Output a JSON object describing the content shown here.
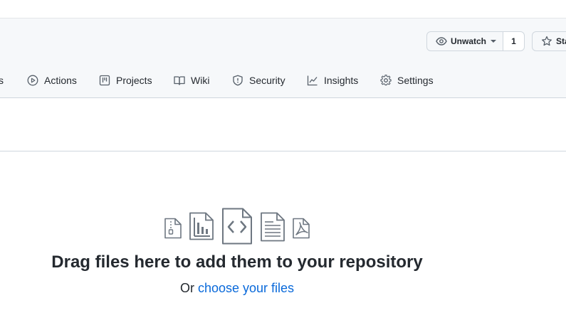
{
  "header": {
    "watch": {
      "label": "Unwatch",
      "count": "1"
    },
    "star": {
      "label": "Star"
    }
  },
  "tabs": [
    {
      "label": "s",
      "icon": "pull-request-icon"
    },
    {
      "label": "Actions",
      "icon": "play-icon"
    },
    {
      "label": "Projects",
      "icon": "table-icon"
    },
    {
      "label": "Wiki",
      "icon": "book-icon"
    },
    {
      "label": "Security",
      "icon": "shield-icon"
    },
    {
      "label": "Insights",
      "icon": "graph-icon"
    },
    {
      "label": "Settings",
      "icon": "gear-icon"
    }
  ],
  "upload": {
    "title": "Drag files here to add them to your repository",
    "or_text": "Or",
    "choose_link": "choose your files",
    "file_icons": [
      "file-zip-icon",
      "file-chart-icon",
      "file-code-icon",
      "file-text-icon",
      "file-pdf-icon"
    ]
  },
  "colors": {
    "link": "#0969da",
    "text": "#24292f",
    "muted": "#57606a",
    "border": "#d0d7de",
    "header_bg": "#f6f8fa"
  }
}
